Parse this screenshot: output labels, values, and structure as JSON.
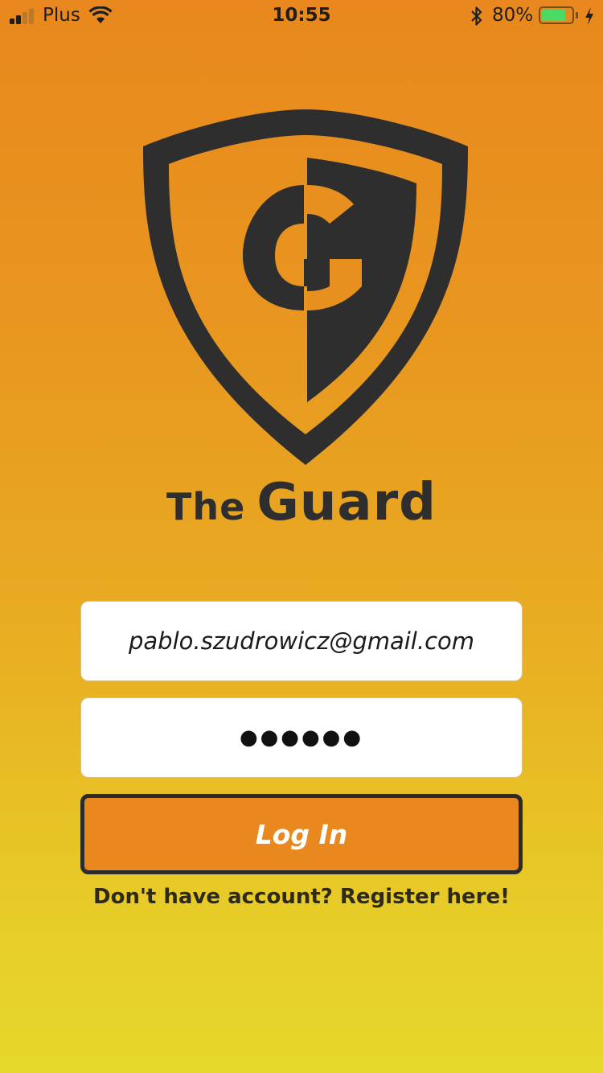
{
  "status_bar": {
    "carrier": "Plus",
    "time": "10:55",
    "battery_percent": "80%",
    "battery_level": 0.8,
    "icons": [
      "signal-icon",
      "wifi-icon",
      "bluetooth-icon",
      "battery-icon",
      "charging-icon"
    ]
  },
  "brand": {
    "prefix": "The",
    "name": "Guard",
    "logo_icon": "shield-g-icon",
    "logo_color": "#2e2e2e"
  },
  "login_form": {
    "email_value": "pablo.szudrowicz@gmail.com",
    "password_masked": "●●●●●●",
    "login_label": "Log In",
    "register_text": "Don't have account? Register here!"
  },
  "colors": {
    "background_top": "#e8881e",
    "background_bottom": "#e6d82b",
    "button_fill": "#e8881e",
    "button_border": "#2b2b2b",
    "battery_fill": "#4cd964"
  }
}
